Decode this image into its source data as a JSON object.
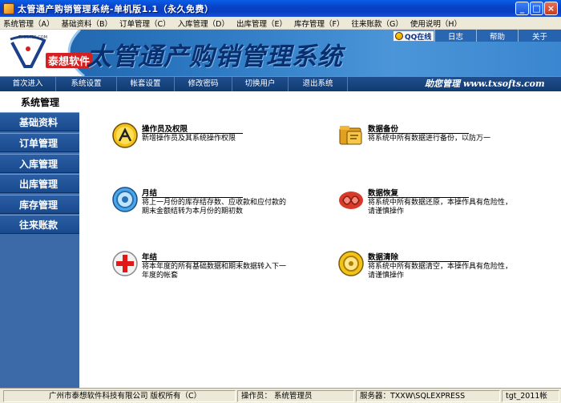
{
  "window": {
    "title": "太管通产购销管理系统-单机版1.1（永久免费）"
  },
  "menu": {
    "items": [
      "系统管理（A）",
      "基础资料（B）",
      "订单管理（C）",
      "入库管理（D）",
      "出库管理（E）",
      "库存管理（F）",
      "往来账款（G）",
      "使用说明（H）"
    ]
  },
  "header": {
    "logo_text": "泰想软件",
    "logo_url": "TXSOFTS.COM",
    "title": "太管通产购销管理系统",
    "qq": "QQ在线",
    "links": {
      "log": "日志",
      "help": "帮助",
      "about": "关于"
    }
  },
  "nav": {
    "items": [
      "首次进入",
      "系统设置",
      "帐套设置",
      "修改密码",
      "切换用户",
      "退出系统"
    ],
    "slogan": "助您管理 www.txsofts.com"
  },
  "sidebar": {
    "title": "系统管理",
    "items": [
      "基础资料",
      "订单管理",
      "入库管理",
      "出库管理",
      "库存管理",
      "往来账款"
    ]
  },
  "cards": [
    {
      "title": "操作员及权限",
      "desc": "新增操作员及其系统操作权限",
      "icon": "key-user-icon"
    },
    {
      "title": "数据备份",
      "desc": "将系统中所有数据进行备份，以防万一",
      "icon": "backup-folder-icon"
    },
    {
      "title": "月结",
      "desc": "将上一月份的库存结存数、应收款和应付款的期末金额结转为本月份的期初数",
      "icon": "month-end-icon"
    },
    {
      "title": "数据恢复",
      "desc": "将系统中所有数据还原，本操作具有危险性，请谨慎操作",
      "icon": "restore-icon"
    },
    {
      "title": "年结",
      "desc": "将本年度的所有基础数据和期末数据转入下一年度的帐套",
      "icon": "year-end-icon"
    },
    {
      "title": "数据清除",
      "desc": "将系统中所有数据清空，本操作具有危险性，请谨慎操作",
      "icon": "clear-data-icon"
    }
  ],
  "status": {
    "company": "广州市泰想软件科技有限公司 版权所有（C）",
    "operator": "操作员：  系统管理员",
    "server": "服务器：TXXW\\SQLEXPRESS",
    "extra": "tgt_2011帐"
  }
}
